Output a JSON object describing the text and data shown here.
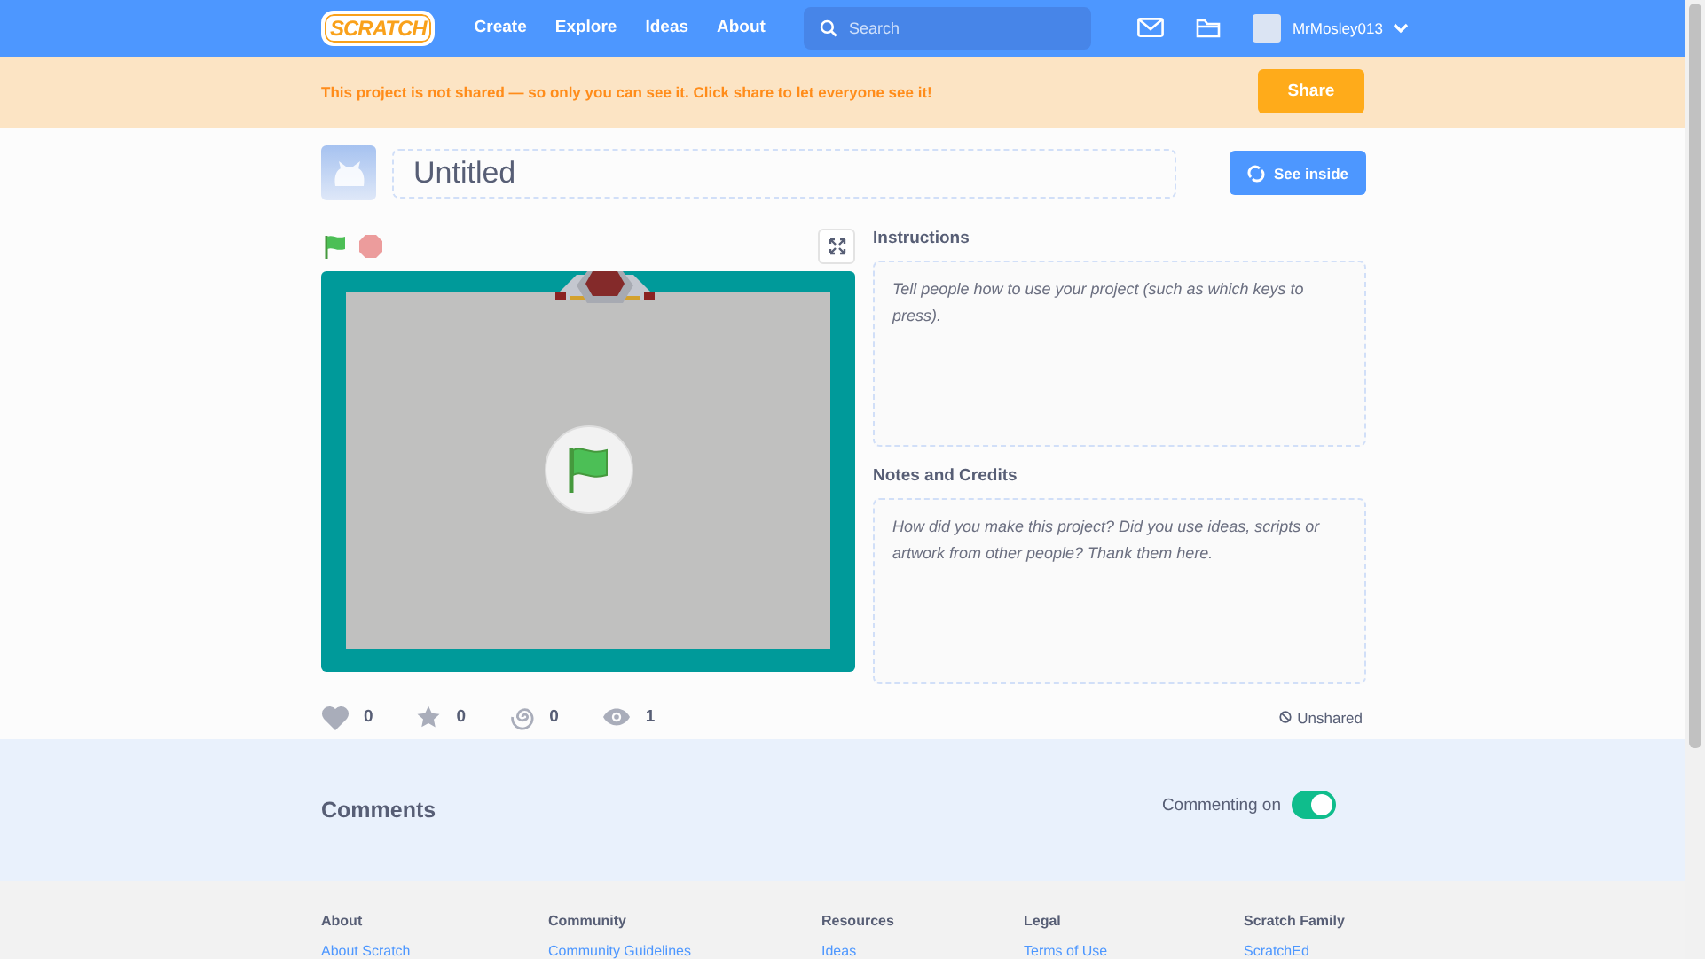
{
  "nav": {
    "logo": "SCRATCH",
    "links": [
      "Create",
      "Explore",
      "Ideas",
      "About"
    ],
    "search": {
      "placeholder": "Search"
    },
    "username": "MrMosley013"
  },
  "banner": {
    "message": "This project is not shared — so only you can see it. Click share to let everyone see it!",
    "button": "Share"
  },
  "project": {
    "title": "Untitled",
    "see_inside": "See inside"
  },
  "instructions": {
    "heading": "Instructions",
    "placeholder": "Tell people how to use your project (such as which keys to press)."
  },
  "notes": {
    "heading": "Notes and Credits",
    "placeholder": "How did you make this project? Did you use ideas, scripts or artwork from other people? Thank them here."
  },
  "stats": [
    {
      "kind": "love",
      "count": "0"
    },
    {
      "kind": "favorite",
      "count": "0"
    },
    {
      "kind": "remix",
      "count": "0"
    },
    {
      "kind": "view",
      "count": "1"
    }
  ],
  "share_status": "Unshared",
  "comments": {
    "heading": "Comments",
    "toggle_label": "Commenting on",
    "on": true
  },
  "footer": [
    {
      "heading": "About",
      "link": "About Scratch"
    },
    {
      "heading": "Community",
      "link": "Community Guidelines"
    },
    {
      "heading": "Resources",
      "link": "Ideas"
    },
    {
      "heading": "Legal",
      "link": "Terms of Use"
    },
    {
      "heading": "Scratch Family",
      "link": "ScratchEd"
    }
  ]
}
